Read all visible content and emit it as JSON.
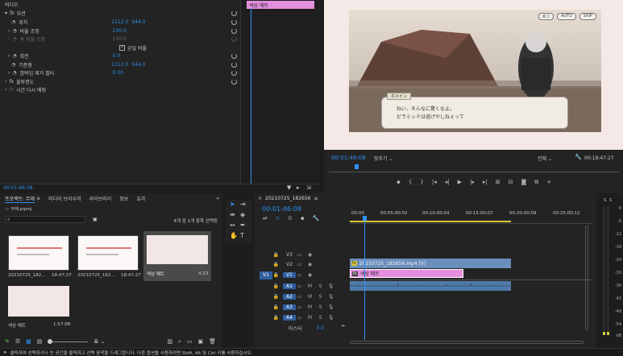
{
  "effect_controls": {
    "section": "비디오",
    "clip_label": "색상 매트",
    "motion": "모션",
    "position": {
      "label": "위치",
      "x": "1112.0",
      "y": "544.0"
    },
    "scale": {
      "label": "비율 조정",
      "value": "100.0"
    },
    "scale_width": {
      "label": "폭 비율 조정",
      "value": "100.0"
    },
    "uniform_scale": "균일 비율",
    "rotation": {
      "label": "회전",
      "value": "0.0"
    },
    "anchor": {
      "label": "기준점",
      "x": "1112.0",
      "y": "544.0"
    },
    "anti_flicker": {
      "label": "깜박임 제거 필터",
      "value": "0.00"
    },
    "opacity": "불투명도",
    "time_remap": "시간 다시 매핑",
    "timecode": "00:01:46:08"
  },
  "program_monitor": {
    "game_buttons": [
      "로그",
      "AUTO",
      "SKIP"
    ],
    "dialog_name": "ホメイン",
    "dialog_line1": "ねい、そんなに驚くなよ。",
    "dialog_line2": "ピラミッドは逃げやしねぇって",
    "timecode": "00:01:46:08",
    "fit": "맞추기",
    "quality": "전체",
    "duration": "00:18:47:27"
  },
  "project": {
    "tabs": [
      "프로젝트: 무제",
      "미디어 브라우저",
      "라이브러리",
      "정보",
      "효과"
    ],
    "file": "무제.prproj",
    "count": "4개 중 1개 항목 선택됨",
    "items": [
      {
        "name": "20210725_182...",
        "dur": "18:47:27"
      },
      {
        "name": "20210725_182...",
        "dur": "18:47:27"
      },
      {
        "name": "색상 매트",
        "dur": "4:23"
      },
      {
        "name": "색상 매트",
        "dur": "1:57:08"
      }
    ]
  },
  "timeline": {
    "sequence": "20210725_182656",
    "timecode": "00:01:46:08",
    "ruler": [
      "00:00",
      "00:05:00:02",
      "00:10:00:04",
      "00:15:00:07",
      "00:20:00:09",
      "00:25:00:12"
    ],
    "video_tracks": [
      "V3",
      "V2",
      "V1"
    ],
    "audio_tracks": [
      "A1",
      "A2",
      "A3",
      "A4"
    ],
    "source_v": "V1",
    "source_a": "A1",
    "master": "마스터",
    "master_val": "0.0",
    "clip_video": "20210725_182656.mp4 [V]",
    "clip_matte": "색상 매트"
  },
  "meter": [
    "0",
    "-6",
    "-12",
    "-18",
    "-24",
    "-30",
    "-36",
    "-42",
    "-48",
    "-54",
    "dB"
  ],
  "meter_labels": [
    "S",
    "S"
  ],
  "status": "클릭하여 선택하거나 빈 공간을 클릭하고 선택 윤곽을 드래그합니다. 다른 옵션을 사용하려면 Shift, Alt 및 Ctrl 키를 사용하십시오."
}
